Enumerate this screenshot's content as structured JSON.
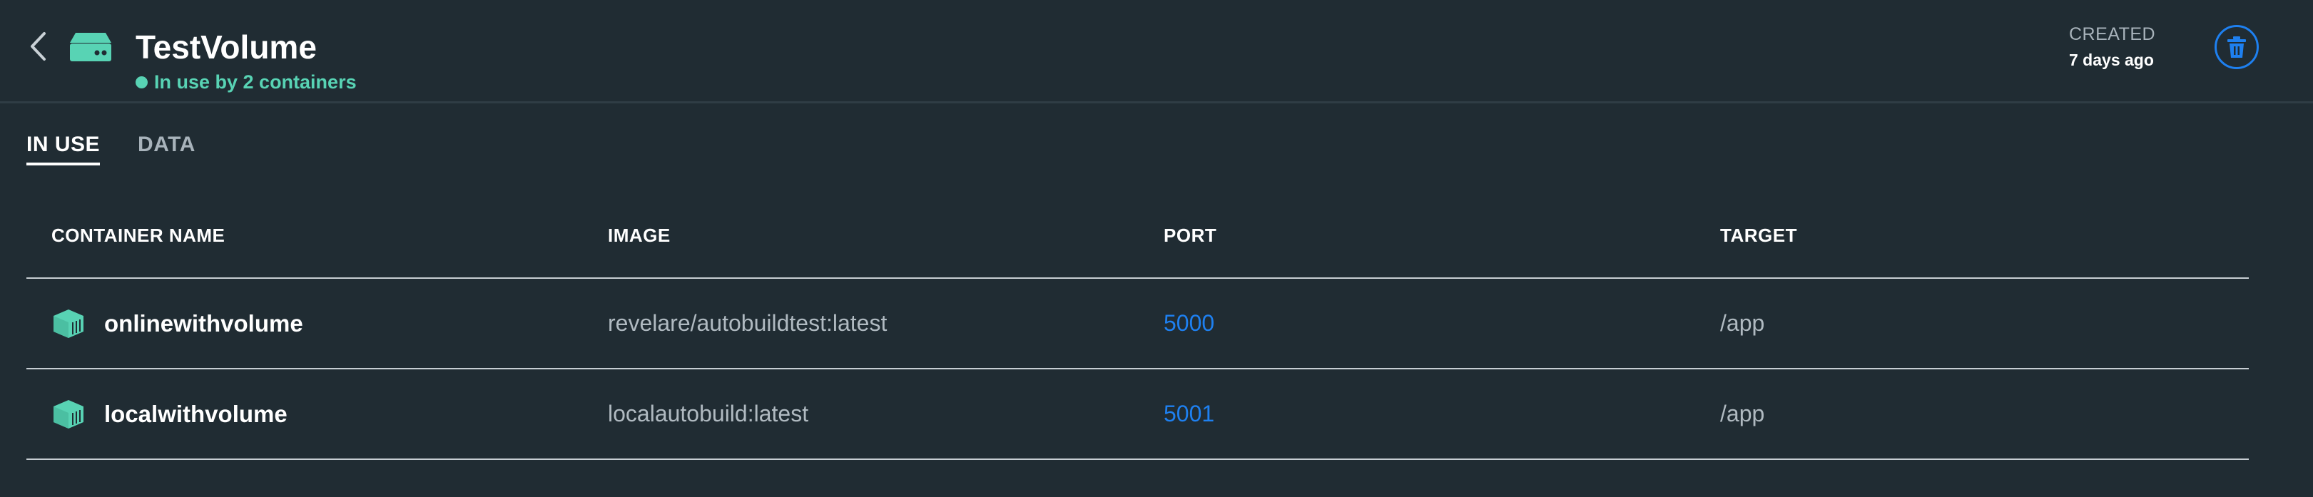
{
  "header": {
    "title": "TestVolume",
    "status": "In use by 2 containers",
    "created_label": "CREATED",
    "created_value": "7 days ago"
  },
  "icons": {
    "back": "chevron-left-icon",
    "volume": "volume-drive-icon",
    "delete": "trash-icon",
    "container": "container-cube-icon"
  },
  "colors": {
    "background": "#202c33",
    "accent": "#58d3b4",
    "link": "#1e80f0"
  },
  "tabs": [
    {
      "label": "IN USE",
      "active": true
    },
    {
      "label": "DATA",
      "active": false
    }
  ],
  "table": {
    "columns": [
      "CONTAINER NAME",
      "IMAGE",
      "PORT",
      "TARGET"
    ],
    "rows": [
      {
        "name": "onlinewithvolume",
        "image": "revelare/autobuildtest:latest",
        "port": "5000",
        "target": "/app"
      },
      {
        "name": "localwithvolume",
        "image": "localautobuild:latest",
        "port": "5001",
        "target": "/app"
      }
    ]
  }
}
